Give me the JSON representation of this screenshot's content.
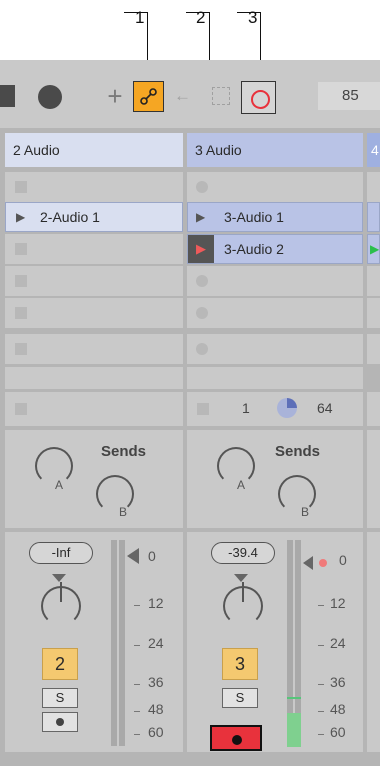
{
  "callouts": {
    "c1": "1",
    "c2": "2",
    "c3": "3"
  },
  "toolbar": {
    "tempo": "85"
  },
  "tracks": [
    {
      "name": "2 Audio",
      "clips": [
        "2-Audio 1"
      ],
      "volume": "-Inf",
      "number": "2",
      "solo": "S"
    },
    {
      "name": "3 Audio",
      "clips": [
        "3-Audio 1",
        "3-Audio 2"
      ],
      "volume": "-39.4",
      "number": "3",
      "solo": "S"
    },
    {
      "name": "4"
    }
  ],
  "scene_row": {
    "value1": "1",
    "value2": "64"
  },
  "sends": {
    "label": "Sends",
    "a": "A",
    "b": "B"
  },
  "meter_ticks": [
    "0",
    "12",
    "24",
    "36",
    "48",
    "60"
  ],
  "colors": {
    "accent": "#f5a623",
    "record": "#e8323c",
    "clip": "#d9dff0",
    "track_head": "#d9dff0"
  }
}
